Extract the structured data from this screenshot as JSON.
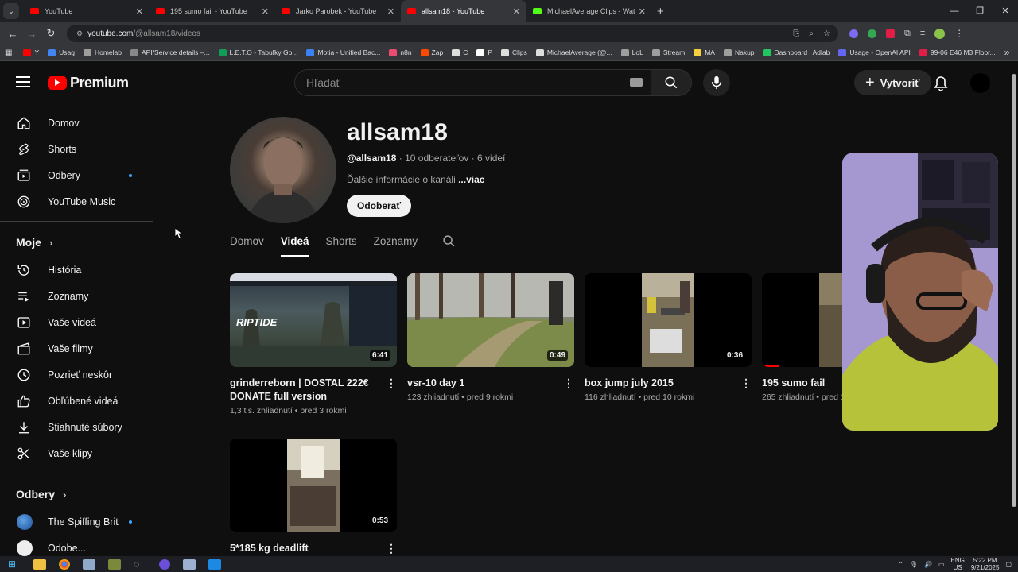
{
  "browser": {
    "tabs": [
      {
        "title": "YouTube",
        "active": false
      },
      {
        "title": "195 sumo fail - YouTube",
        "active": false
      },
      {
        "title": "Jarko Parobek - YouTube",
        "active": false
      },
      {
        "title": "allsam18 - YouTube",
        "active": true
      },
      {
        "title": "MichaelAverage Clips - Watch L",
        "active": false
      }
    ],
    "new_tab": "+",
    "url_host": "youtube.com",
    "url_path": "/@allsam18/videos",
    "bookmarks": [
      {
        "label": "Y",
        "color": "#ff0000"
      },
      {
        "label": "Usag",
        "color": "#4285f4"
      },
      {
        "label": "Homelab",
        "color": "#9e9e9e"
      },
      {
        "label": "API/Service details –...",
        "color": "#888888"
      },
      {
        "label": "L.E.T.O - Tabuľky Go...",
        "color": "#0f9d58"
      },
      {
        "label": "Motia - Unified Bac...",
        "color": "#3b82f6"
      },
      {
        "label": "n8n",
        "color": "#ea4b71"
      },
      {
        "label": "Zap",
        "color": "#ff4a00"
      },
      {
        "label": "C",
        "color": "#dddddd"
      },
      {
        "label": "P",
        "color": "#ffffff"
      },
      {
        "label": "Clips",
        "color": "#dddddd"
      },
      {
        "label": "MichaelAverage (@...",
        "color": "#dddddd"
      },
      {
        "label": "LoL",
        "color": "#9e9e9e"
      },
      {
        "label": "Stream",
        "color": "#9e9e9e"
      },
      {
        "label": "MA",
        "color": "#f4d03f"
      },
      {
        "label": "Nakup",
        "color": "#9e9e9e"
      },
      {
        "label": "Dashboard | Adlab",
        "color": "#22c55e"
      },
      {
        "label": "Usage - OpenAI API",
        "color": "#6366f1"
      },
      {
        "label": "99-06 E46 M3 Floor...",
        "color": "#e11d48"
      }
    ],
    "more_bookmarks": "»"
  },
  "youtube": {
    "logo_text": "Premium",
    "search_placeholder": "Hľadať",
    "create_label": "Vytvoriť",
    "create_plus": "+"
  },
  "sidebar": {
    "main": [
      {
        "label": "Domov",
        "icon": "home-icon"
      },
      {
        "label": "Shorts",
        "icon": "shorts-icon"
      },
      {
        "label": "Odbery",
        "icon": "subscriptions-icon",
        "dot": true
      },
      {
        "label": "YouTube Music",
        "icon": "music-icon"
      }
    ],
    "you_header": "Moje",
    "you": [
      {
        "label": "História",
        "icon": "history-icon"
      },
      {
        "label": "Zoznamy",
        "icon": "playlists-icon"
      },
      {
        "label": "Vaše videá",
        "icon": "your-videos-icon"
      },
      {
        "label": "Vaše filmy",
        "icon": "movies-icon"
      },
      {
        "label": "Pozrieť neskôr",
        "icon": "watch-later-icon"
      },
      {
        "label": "Obľúbené videá",
        "icon": "liked-icon"
      },
      {
        "label": "Stiahnuté súbory",
        "icon": "download-icon"
      },
      {
        "label": "Vaše klipy",
        "icon": "clips-icon"
      }
    ],
    "subs_header": "Odbery",
    "subs": [
      {
        "label": "The Spiffing Brit",
        "dot": true
      },
      {
        "label": "Odobe..."
      }
    ],
    "chevron": "›"
  },
  "channel": {
    "name": "allsam18",
    "handle": "@allsam18",
    "subscribers": "10 odberateľov",
    "video_count": "6 videí",
    "sep": "·",
    "desc_text": "Ďalšie informácie o kanáli",
    "desc_more": "...viac",
    "subscribe_label": "Odoberať",
    "tabs": [
      {
        "label": "Domov",
        "active": false
      },
      {
        "label": "Videá",
        "active": true
      },
      {
        "label": "Shorts",
        "active": false
      },
      {
        "label": "Zoznamy",
        "active": false
      }
    ]
  },
  "videos": [
    {
      "title": "grinderreborn | DOSTAL 222€ DONATE full version",
      "views": "1,3 tis. zhliadnutí",
      "age": "pred 3 rokmi",
      "duration": "6:41"
    },
    {
      "title": "vsr-10 day 1",
      "views": "123 zhliadnutí",
      "age": "pred 9 rokmi",
      "duration": "0:49"
    },
    {
      "title": "box jump july 2015",
      "views": "116 zhliadnutí",
      "age": "pred 10 rokmi",
      "duration": "0:36"
    },
    {
      "title": "195 sumo fail",
      "views": "265 zhliadnutí",
      "age": "pred 1",
      "duration": ""
    },
    {
      "title": "5*185 kg deadlift",
      "views": "",
      "age": "",
      "duration": "0:53"
    }
  ],
  "taskbar": {
    "lang_top": "ENG",
    "lang_bottom": "US",
    "time": "5:22 PM",
    "date": "9/21/2025"
  }
}
